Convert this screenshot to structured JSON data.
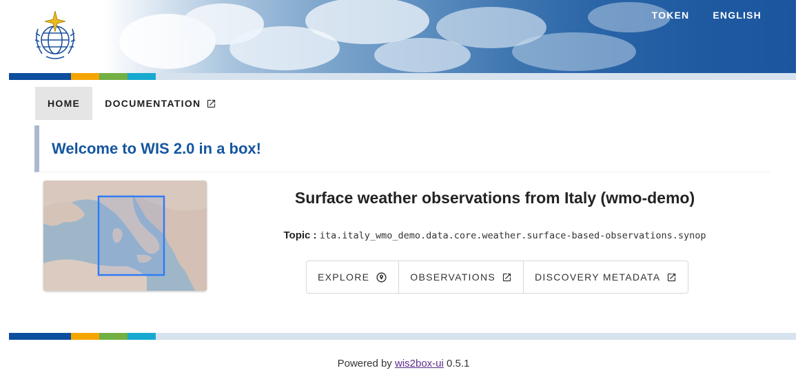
{
  "header": {
    "logo_icon": "wmo-emblem-icon",
    "nav": {
      "token": "TOKEN",
      "language": "ENGLISH"
    }
  },
  "tabs": [
    {
      "label": "HOME",
      "active": true
    },
    {
      "label": "DOCUMENTATION",
      "icon": "open-in-new-icon"
    }
  ],
  "welcome": {
    "title": "Welcome to WIS 2.0 in a box!"
  },
  "dataset": {
    "title": "Surface weather observations from Italy (wmo-demo)",
    "topic_label": "Topic :",
    "topic_value": "ita.italy_wmo_demo.data.core.weather.surface-based-observations.synop",
    "buttons": [
      {
        "label": "EXPLORE",
        "icon": "map-marker-icon"
      },
      {
        "label": "OBSERVATIONS",
        "icon": "open-in-new-icon"
      },
      {
        "label": "DISCOVERY METADATA",
        "icon": "open-in-new-icon"
      }
    ]
  },
  "footer": {
    "prefix": "Powered by",
    "link": "wis2box-ui",
    "version": "0.5.1"
  },
  "colors": {
    "brand_blue": "#1556a0",
    "stripe": [
      "#0d4e9e",
      "#f5a500",
      "#72b043",
      "#17a9cf",
      "#d6e2ee"
    ]
  }
}
